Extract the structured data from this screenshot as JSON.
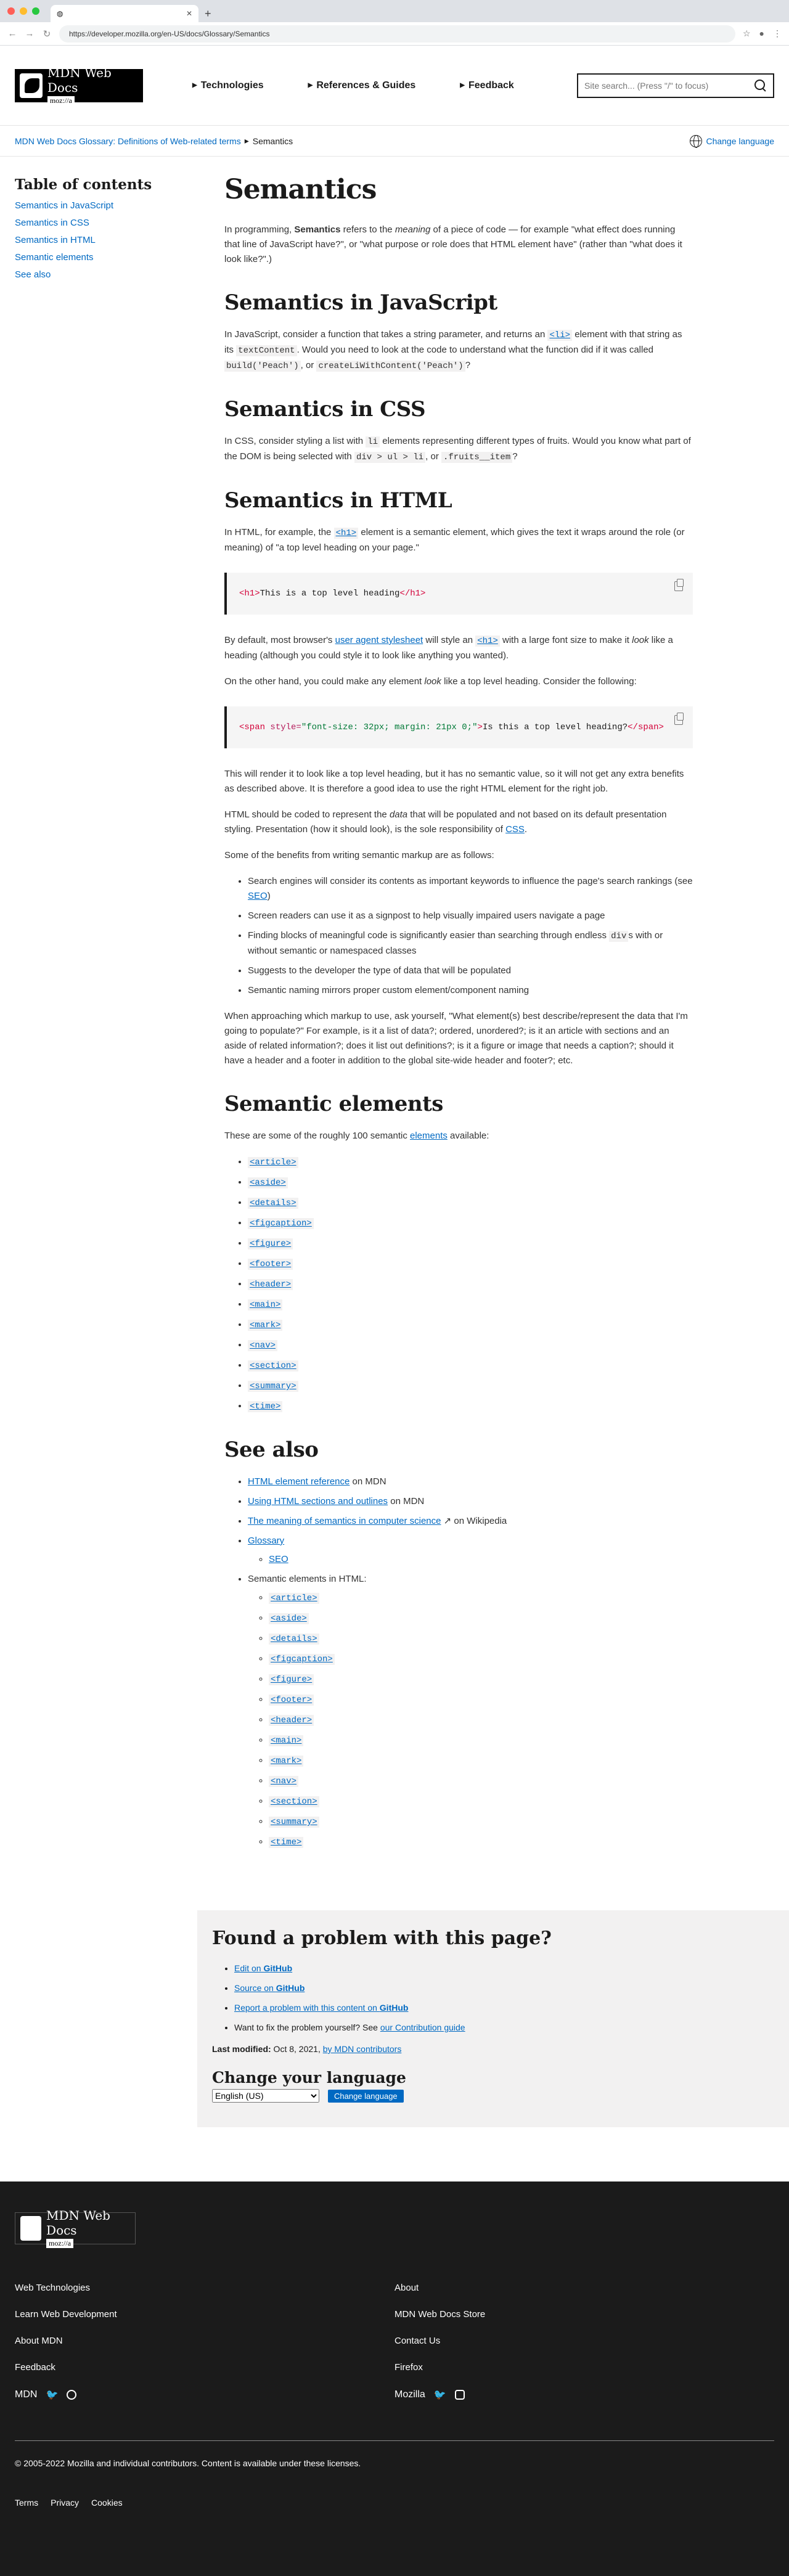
{
  "browser": {
    "tab_title": "",
    "url": "https://developer.mozilla.org/en-US/docs/Glossary/Semantics"
  },
  "header": {
    "logo_text": "MDN Web Docs",
    "logo_sub": "moz://a",
    "nav": [
      "Technologies",
      "References & Guides",
      "Feedback"
    ],
    "search_placeholder": "Site search... (Press \"/\" to focus)"
  },
  "breadcrumb": {
    "parent": "MDN Web Docs Glossary: Definitions of Web-related terms",
    "current": "Semantics",
    "change_language": "Change language"
  },
  "toc": {
    "title": "Table of contents",
    "items": [
      "Semantics in JavaScript",
      "Semantics in CSS",
      "Semantics in HTML",
      "Semantic elements",
      "See also"
    ]
  },
  "article": {
    "title": "Semantics",
    "intro_1": "In programming, ",
    "intro_bold": "Semantics",
    "intro_2": " refers to the ",
    "intro_em": "meaning",
    "intro_3": " of a piece of code — for example \"what effect does running that line of JavaScript have?\", or \"what purpose or role does that HTML element have\" (rather than \"what does it look like?\".)",
    "js_heading": "Semantics in JavaScript",
    "js_p1": "In JavaScript, consider a function that takes a string parameter, and returns an ",
    "js_li_link": "<li>",
    "js_p2": " element with that string as its ",
    "js_code1": "textContent",
    "js_p3": ". Would you need to look at the code to understand what the function did if it was called ",
    "js_code2": "build('Peach')",
    "js_p4": ", or ",
    "js_code3": "createLiWithContent('Peach')",
    "js_p5": "?",
    "css_heading": "Semantics in CSS",
    "css_p1": "In CSS, consider styling a list with ",
    "css_code1": "li",
    "css_p2": " elements representing different types of fruits. Would you know what part of the DOM is being selected with ",
    "css_code2": "div > ul > li",
    "css_p3": ", or ",
    "css_code3": ".fruits__item",
    "css_p4": "?",
    "html_heading": "Semantics in HTML",
    "html_p1": "In HTML, for example, the ",
    "html_h1_link": "<h1>",
    "html_p2": " element is a semantic element, which gives the text it wraps around the role (or meaning) of \"a top level heading on your page.\"",
    "code1": {
      "open": "<h1>",
      "text": "This is a top level heading",
      "close": "</h1>"
    },
    "html_p3_a": "By default, most browser's ",
    "html_p3_link": "user agent stylesheet",
    "html_p3_b": " will style an ",
    "html_p3_code": "<h1>",
    "html_p3_c": " with a large font size to make it ",
    "html_p3_em": "look",
    "html_p3_d": " like a heading (although you could style it to look like anything you wanted).",
    "html_p4_a": "On the other hand, you could make any element ",
    "html_p4_em": "look",
    "html_p4_b": " like a top level heading. Consider the following:",
    "code2": {
      "open_tag": "<span",
      "attr": " style=",
      "val": "\"font-size: 32px; margin: 21px 0;\"",
      "gt": ">",
      "text": "Is this a top level heading?",
      "close": "</span>"
    },
    "html_p5": "This will render it to look like a top level heading, but it has no semantic value, so it will not get any extra benefits as described above. It is therefore a good idea to use the right HTML element for the right job.",
    "html_p6_a": "HTML should be coded to represent the ",
    "html_p6_em": "data",
    "html_p6_b": " that will be populated and not based on its default presentation styling. Presentation (how it should look), is the sole responsibility of ",
    "html_p6_link": "CSS",
    "html_p6_c": ".",
    "html_p7": "Some of the benefits from writing semantic markup are as follows:",
    "benefits": [
      "Search engines will consider its contents as important keywords to influence the page's search rankings (see ",
      "Screen readers can use it as a signpost to help visually impaired users navigate a page",
      "Finding blocks of meaningful code is significantly easier than searching through endless ",
      "Suggests to the developer the type of data that will be populated",
      "Semantic naming mirrors proper custom element/component naming"
    ],
    "benefit_seo": "SEO",
    "benefit_seo_end": ")",
    "benefit_divs": "div",
    "benefit_divs_end": "s with or without semantic or namespaced classes",
    "html_p8": "When approaching which markup to use, ask yourself, \"What element(s) best describe/represent the data that I'm going to populate?\" For example, is it a list of data?; ordered, unordered?; is it an article with sections and an aside of related information?; does it list out definitions?; is it a figure or image that needs a caption?; should it have a header and a footer in addition to the global site-wide header and footer?; etc.",
    "sem_heading": "Semantic elements",
    "sem_p_a": "These are some of the roughly 100 semantic ",
    "sem_p_link": "elements",
    "sem_p_b": " available:",
    "elements": [
      "<article>",
      "<aside>",
      "<details>",
      "<figcaption>",
      "<figure>",
      "<footer>",
      "<header>",
      "<main>",
      "<mark>",
      "<nav>",
      "<section>",
      "<summary>",
      "<time>"
    ],
    "see_heading": "See also",
    "see_1_link": "HTML element reference",
    "see_1_rest": " on MDN",
    "see_2_link": "Using HTML sections and outlines",
    "see_2_rest": " on MDN",
    "see_3_link": "The meaning of semantics in computer science",
    "see_3_rest": " on Wikipedia",
    "see_4_link": "Glossary",
    "see_4_sub": "SEO",
    "see_5": "Semantic elements in HTML:"
  },
  "problem": {
    "title": "Found a problem with this page?",
    "edit_a": "Edit on ",
    "edit_b": "GitHub",
    "source_a": "Source on ",
    "source_b": "GitHub",
    "report_a": "Report a problem with this content on ",
    "report_b": "GitHub",
    "fix_a": "Want to fix the problem yourself? See ",
    "fix_link": "our Contribution guide",
    "modified_label": "Last modified:",
    "modified_date": " Oct 8, 2021, ",
    "modified_link": "by MDN contributors",
    "lang_title": "Change your language",
    "lang_option": "English (US)",
    "lang_button": "Change language"
  },
  "footer": {
    "logo_text": "MDN Web Docs",
    "logo_sub": "moz://a",
    "left_links": [
      "Web Technologies",
      "Learn Web Development",
      "About MDN",
      "Feedback"
    ],
    "right_links": [
      "About",
      "MDN Web Docs Store",
      "Contact Us",
      "Firefox"
    ],
    "left_brand": "MDN",
    "right_brand": "Mozilla",
    "copyright": "© 2005-2022 Mozilla and individual contributors. Content is available under these licenses.",
    "legal": [
      "Terms",
      "Privacy",
      "Cookies"
    ]
  },
  "colors": {
    "link": "#0069c2",
    "text": "#1b1b1b",
    "footer_bg": "#1b1b1b",
    "problem_bg": "#f2f1f1"
  }
}
